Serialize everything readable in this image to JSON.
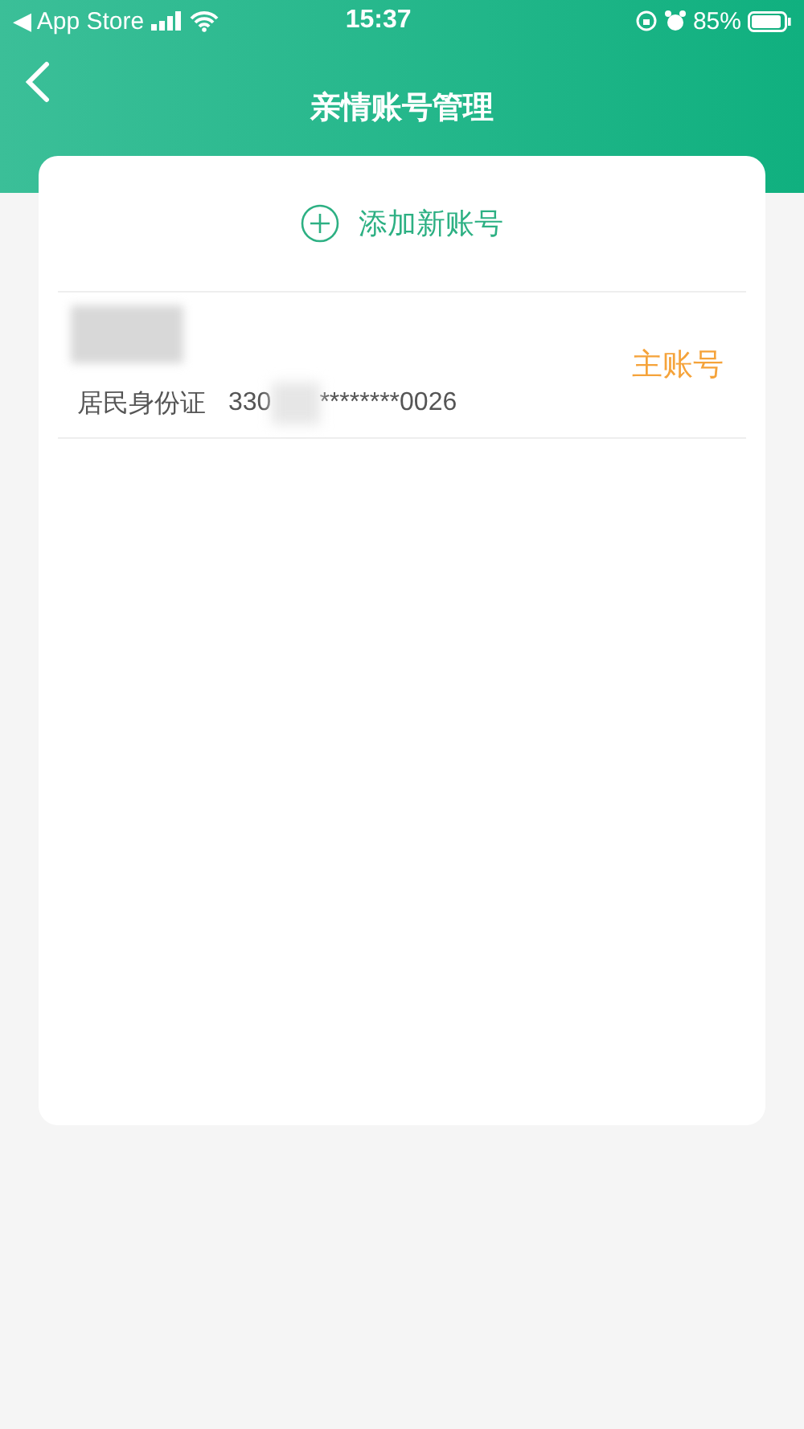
{
  "status_bar": {
    "back_label": "◀ App Store",
    "time": "15:37",
    "battery": "85%"
  },
  "header": {
    "title": "亲情账号管理"
  },
  "add_account": {
    "label": "添加新账号"
  },
  "accounts": [
    {
      "id_type": "居民身份证",
      "id_prefix": "330",
      "id_suffix": "********0026",
      "badge": "主账号"
    }
  ]
}
